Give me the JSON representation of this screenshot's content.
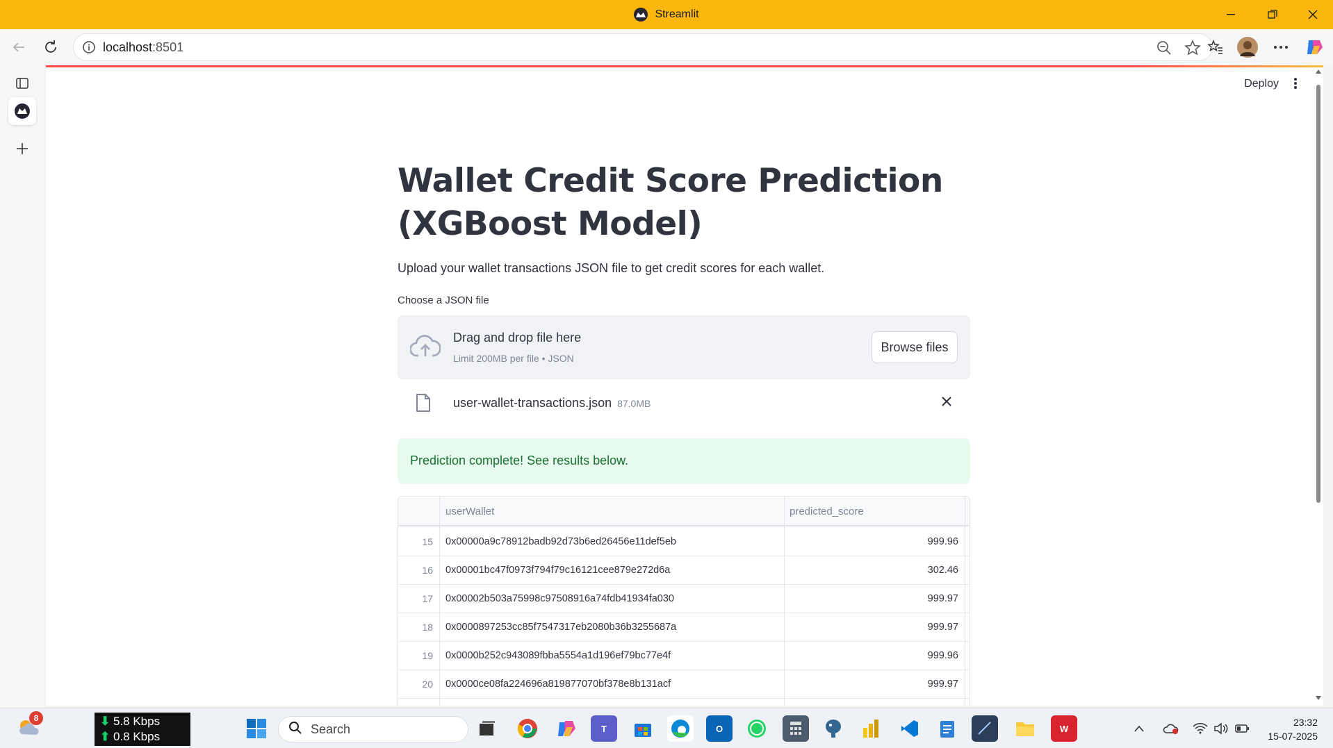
{
  "window": {
    "title": "Streamlit"
  },
  "browser": {
    "url_host": "localhost",
    "url_port": ":8501"
  },
  "app": {
    "deploy_label": "Deploy",
    "title": "Wallet Credit Score Prediction (XGBoost Model)",
    "subtitle": "Upload your wallet transactions JSON file to get credit scores for each wallet.",
    "uploader": {
      "label": "Choose a JSON file",
      "drop_text": "Drag and drop file here",
      "limit_text": "Limit 200MB per file • JSON",
      "browse_label": "Browse files"
    },
    "file": {
      "name": "user-wallet-transactions.json",
      "size": "87.0MB"
    },
    "success_message": "Prediction complete! See results below.",
    "table": {
      "columns": [
        "userWallet",
        "predicted_score"
      ],
      "rows": [
        {
          "index": "15",
          "userWallet": "0x00000a9c78912badb92d73b6ed26456e11def5eb",
          "predicted_score": "999.96"
        },
        {
          "index": "16",
          "userWallet": "0x00001bc47f0973f794f79c16121cee879e272d6a",
          "predicted_score": "302.46"
        },
        {
          "index": "17",
          "userWallet": "0x00002b503a75998c97508916a74fdb41934fa030",
          "predicted_score": "999.97"
        },
        {
          "index": "18",
          "userWallet": "0x0000897253cc85f7547317eb2080b36b3255687a",
          "predicted_score": "999.97"
        },
        {
          "index": "19",
          "userWallet": "0x0000b252c943089fbba5554a1d196ef79bc77e4f",
          "predicted_score": "999.96"
        },
        {
          "index": "20",
          "userWallet": "0x0000ce08fa224696a819877070bf378e8b131acf",
          "predicted_score": "999.97"
        }
      ]
    }
  },
  "taskbar": {
    "weather_badge": "8",
    "net_down": "5.8 Kbps",
    "net_up": "0.8 Kbps",
    "search_placeholder": "Search",
    "time": "23:32",
    "date": "15-07-2025"
  },
  "colors": {
    "titlebar": "#fbb70e",
    "success_bg": "#e8f9ee",
    "success_text": "#177233",
    "accent": "#ff4b4b"
  }
}
